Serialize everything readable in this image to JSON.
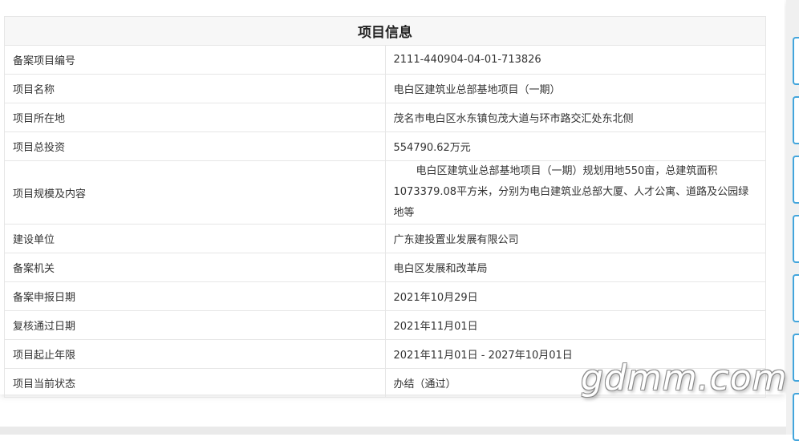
{
  "table": {
    "title": "项目信息",
    "rows": [
      {
        "label": "备案项目编号",
        "value": "2111-440904-04-01-713826"
      },
      {
        "label": "项目名称",
        "value": "电白区建筑业总部基地项目（一期）"
      },
      {
        "label": "项目所在地",
        "value": "茂名市电白区水东镇包茂大道与环市路交汇处东北侧"
      },
      {
        "label": "项目总投资",
        "value": "554790.62万元"
      },
      {
        "label": "项目规模及内容",
        "value": "电白区建筑业总部基地项目（一期）规划用地550亩，总建筑面积1073379.08平方米，分别为电白建筑业总部大厦、人才公寓、道路及公园绿地等"
      },
      {
        "label": "建设单位",
        "value": "广东建投置业发展有限公司"
      },
      {
        "label": "备案机关",
        "value": "电白区发展和改革局"
      },
      {
        "label": "备案申报日期",
        "value": "2021年10月29日"
      },
      {
        "label": "复核通过日期",
        "value": "2021年11月01日"
      },
      {
        "label": "项目起止年限",
        "value": "2021年11月01日 - 2027年10月01日"
      },
      {
        "label": "项目当前状态",
        "value": "办结（通过）"
      }
    ]
  },
  "watermark": "gdmm.com",
  "colors": {
    "border": "#e6e6e6",
    "header_bg": "#f7f7f7",
    "accent": "#42a5dc"
  }
}
